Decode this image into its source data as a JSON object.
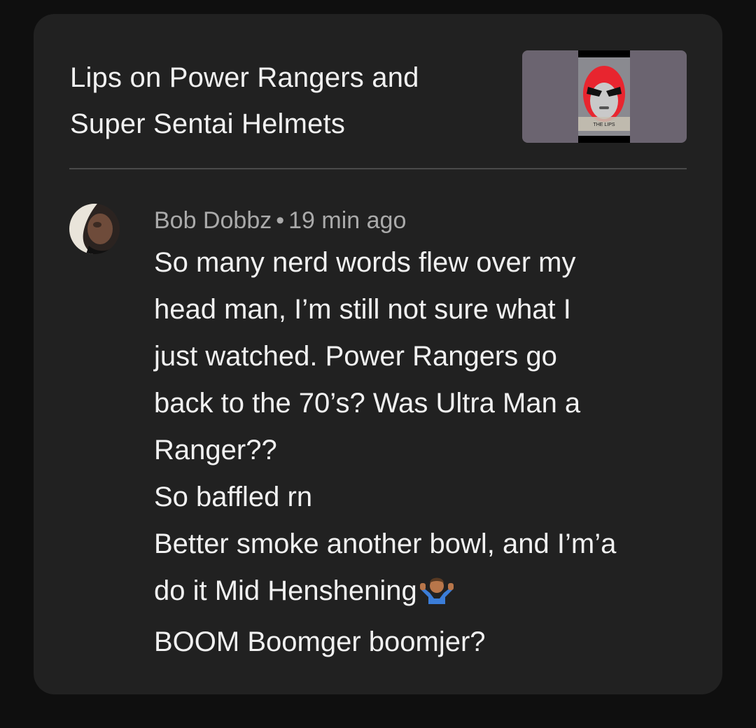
{
  "video": {
    "title_line1": "Lips on Power Rangers and",
    "title_line2": "Super Sentai Helmets",
    "thumbnail_icon": "red-ranger-helmet-thumbnail",
    "thumbnail_caption": "THE LIPS"
  },
  "comment": {
    "author": "Bob Dobbz",
    "separator": "•",
    "time": "19 min ago",
    "lines": [
      "So many nerd words flew over my",
      "head man, I’m still not sure what I",
      "just watched. Power Rangers go",
      "back to the 70’s? Was Ultra Man a",
      "Ranger??",
      "So baffled rn",
      "Better smoke another bowl, and I’m’a",
      "do it Mid Henshening",
      "BOOM Boomger boomjer?"
    ],
    "emoji": "shrug-emoji"
  },
  "colors": {
    "background": "#0f0f0f",
    "card": "#212121",
    "text_primary": "#f1f1f1",
    "text_secondary": "#aaaaaa",
    "divider": "#4a4a4a"
  }
}
